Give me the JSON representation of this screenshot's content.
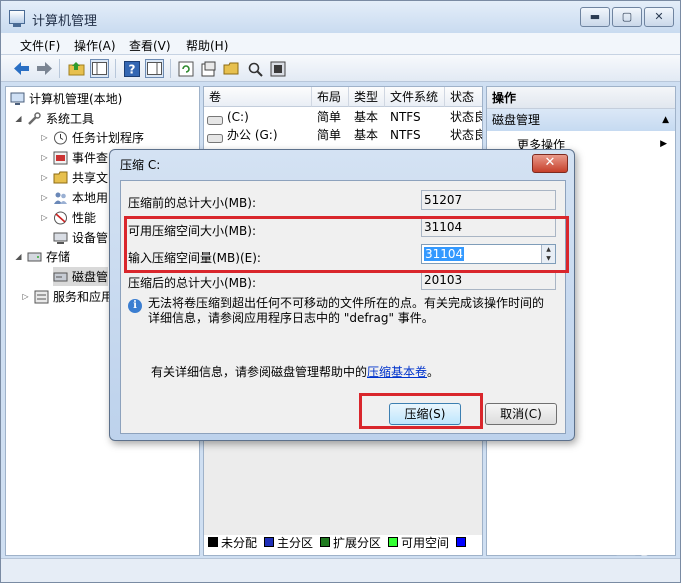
{
  "window": {
    "title": "计算机管理"
  },
  "menu": [
    "文件(F)",
    "操作(A)",
    "查看(V)",
    "帮助(H)"
  ],
  "toolbar_icons": [
    "back-icon",
    "forward-icon",
    "up-folder-icon",
    "show-tree-icon",
    "help-icon",
    "panel-icon",
    "refresh-icon",
    "properties-icon",
    "open-folder-icon",
    "search-icon",
    "settings-icon"
  ],
  "tree": {
    "root": "计算机管理(本地)",
    "system_tools": "系统工具",
    "task_scheduler": "任务计划程序",
    "event_viewer": "事件查",
    "shared_folders": "共享文",
    "local_users": "本地用",
    "performance": "性能",
    "device_manager": "设备管",
    "storage": "存储",
    "disk_management": "磁盘管",
    "services": "服务和应用"
  },
  "volume_table": {
    "headers": [
      "卷",
      "布局",
      "类型",
      "文件系统",
      "状态"
    ],
    "rows": [
      {
        "volume": "(C:)",
        "layout": "简单",
        "type": "基本",
        "fs": "NTFS",
        "status": "状态良"
      },
      {
        "volume": "办公 (G:)",
        "layout": "简单",
        "type": "基本",
        "fs": "NTFS",
        "status": "状态良"
      }
    ]
  },
  "legend": [
    "未分配",
    "主分区",
    "扩展分区",
    "可用空间"
  ],
  "legend_colors": [
    "#000000",
    "#1f2fb8",
    "#1f7a1f",
    "#33ff33",
    "#0000ff"
  ],
  "actions": {
    "header": "操作",
    "group": "磁盘管理",
    "more": "更多操作"
  },
  "dialog": {
    "title": "压缩 C:",
    "close": "✕",
    "total_before_label": "压缩前的总计大小(MB):",
    "total_before_value": "51207",
    "available_label": "可用压缩空间大小(MB):",
    "available_value": "31104",
    "input_label": "输入压缩空间量(MB)(E):",
    "input_value": "31104",
    "total_after_label": "压缩后的总计大小(MB):",
    "total_after_value": "20103",
    "info_text": "无法将卷压缩到超出任何不可移动的文件所在的点。有关完成该操作时间的详细信息，请参阅应用程序日志中的 \"defrag\" 事件。",
    "more_prefix": "有关详细信息，请参阅磁盘管理帮助中的",
    "more_link": "压缩基本卷",
    "more_suffix": "。",
    "shrink_button": "压缩(S)",
    "cancel_button": "取消(C)"
  },
  "watermark": "Bai 经验"
}
